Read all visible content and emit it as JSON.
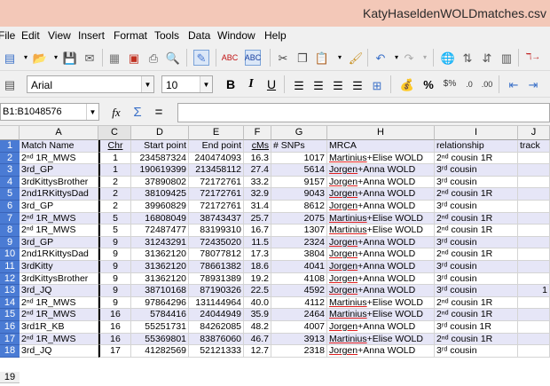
{
  "window": {
    "title": "KatyHaseldenWOLDmatches.csv"
  },
  "menu": [
    "File",
    "Edit",
    "View",
    "Insert",
    "Format",
    "Tools",
    "Data",
    "Window",
    "Help"
  ],
  "formatting": {
    "font_name": "Arial",
    "font_size": "10"
  },
  "formula_bar": {
    "name_box": "B1:B1048576",
    "content": ""
  },
  "columns": [
    "A",
    "C",
    "D",
    "E",
    "F",
    "G",
    "H",
    "I",
    "J"
  ],
  "header_row": {
    "num": "1",
    "cells": [
      "Match Name",
      "Chr",
      "Start point",
      "End point",
      "cMs",
      "# SNPs",
      "MRCA",
      "relationship",
      "track"
    ]
  },
  "rows": [
    {
      "num": "2",
      "name": "2ⁿᵈ 1R_MWS",
      "chr": "1",
      "start": "234587324",
      "end": "240474093",
      "cms": "16.3",
      "snps": "1017",
      "mrca": "Martinius+Elise WOLD",
      "rel": "2ⁿᵈ cousin 1R",
      "track": ""
    },
    {
      "num": "3",
      "name": "3rd_GP",
      "chr": "1",
      "start": "190619399",
      "end": "213458112",
      "cms": "27.4",
      "snps": "5614",
      "mrca": "Jorgen+Anna WOLD",
      "rel": "3ʳᵈ cousin",
      "track": ""
    },
    {
      "num": "4",
      "name": "3rdKittysBrother",
      "chr": "2",
      "start": "37890802",
      "end": "72172761",
      "cms": "33.2",
      "snps": "9157",
      "mrca": "Jorgen+Anna WOLD",
      "rel": "3ʳᵈ cousin",
      "track": ""
    },
    {
      "num": "5",
      "name": "2nd1RKittysDad",
      "chr": "2",
      "start": "38109425",
      "end": "72172761",
      "cms": "32.9",
      "snps": "9043",
      "mrca": "Jorgen+Anna WOLD",
      "rel": "2ⁿᵈ cousin 1R",
      "track": ""
    },
    {
      "num": "6",
      "name": "3rd_GP",
      "chr": "2",
      "start": "39960829",
      "end": "72172761",
      "cms": "31.4",
      "snps": "8612",
      "mrca": "Jorgen+Anna WOLD",
      "rel": "3ʳᵈ cousin",
      "track": ""
    },
    {
      "num": "7",
      "name": "2ⁿᵈ 1R_MWS",
      "chr": "5",
      "start": "16808049",
      "end": "38743437",
      "cms": "25.7",
      "snps": "2075",
      "mrca": "Martinius+Elise WOLD",
      "rel": "2ⁿᵈ cousin 1R",
      "track": ""
    },
    {
      "num": "8",
      "name": "2ⁿᵈ 1R_MWS",
      "chr": "5",
      "start": "72487477",
      "end": "83199310",
      "cms": "16.7",
      "snps": "1307",
      "mrca": "Martinius+Elise WOLD",
      "rel": "2ⁿᵈ cousin 1R",
      "track": ""
    },
    {
      "num": "9",
      "name": "3rd_GP",
      "chr": "9",
      "start": "31243291",
      "end": "72435020",
      "cms": "11.5",
      "snps": "2324",
      "mrca": "Jorgen+Anna WOLD",
      "rel": "3ʳᵈ cousin",
      "track": ""
    },
    {
      "num": "10",
      "name": "2nd1RKittysDad",
      "chr": "9",
      "start": "31362120",
      "end": "78077812",
      "cms": "17.3",
      "snps": "3804",
      "mrca": "Jorgen+Anna WOLD",
      "rel": "2ⁿᵈ cousin 1R",
      "track": ""
    },
    {
      "num": "11",
      "name": "3rdKitty",
      "chr": "9",
      "start": "31362120",
      "end": "78661382",
      "cms": "18.6",
      "snps": "4041",
      "mrca": "Jorgen+Anna WOLD",
      "rel": "3ʳᵈ cousin",
      "track": ""
    },
    {
      "num": "12",
      "name": "3rdKittysBrother",
      "chr": "9",
      "start": "31362120",
      "end": "78931389",
      "cms": "19.2",
      "snps": "4108",
      "mrca": "Jorgen+Anna WOLD",
      "rel": "3ʳᵈ cousin",
      "track": ""
    },
    {
      "num": "13",
      "name": "3rd_JQ",
      "chr": "9",
      "start": "38710168",
      "end": "87190326",
      "cms": "22.5",
      "snps": "4592",
      "mrca": "Jorgen+Anna WOLD",
      "rel": "3ʳᵈ cousin",
      "track": "1"
    },
    {
      "num": "14",
      "name": "2ⁿᵈ 1R_MWS",
      "chr": "9",
      "start": "97864296",
      "end": "131144964",
      "cms": "40.0",
      "snps": "4112",
      "mrca": "Martinius+Elise WOLD",
      "rel": "2ⁿᵈ cousin 1R",
      "track": ""
    },
    {
      "num": "15",
      "name": "2ⁿᵈ 1R_MWS",
      "chr": "16",
      "start": "5784416",
      "end": "24044949",
      "cms": "35.9",
      "snps": "2464",
      "mrca": "Martinius+Elise WOLD",
      "rel": "2ⁿᵈ cousin 1R",
      "track": ""
    },
    {
      "num": "16",
      "name": "3rd1R_KB",
      "chr": "16",
      "start": "55251731",
      "end": "84262085",
      "cms": "48.2",
      "snps": "4007",
      "mrca": "Jorgen+Anna WOLD",
      "rel": "3ʳᵈ cousin 1R",
      "track": ""
    },
    {
      "num": "17",
      "name": "2ⁿᵈ 1R_MWS",
      "chr": "16",
      "start": "55369801",
      "end": "83876060",
      "cms": "46.7",
      "snps": "3913",
      "mrca": "Martinius+Elise WOLD",
      "rel": "2ⁿᵈ cousin 1R",
      "track": ""
    },
    {
      "num": "18",
      "name": "3rd_JQ",
      "chr": "17",
      "start": "41282569",
      "end": "52121333",
      "cms": "12.7",
      "snps": "2318",
      "mrca": "Jorgen+Anna WOLD",
      "rel": "3ʳᵈ cousin",
      "track": ""
    }
  ],
  "trailing_row": {
    "num": "19"
  },
  "colors": {
    "title_bar": "#f3c8b8",
    "row_header_selected": "#4a7bd4",
    "row_band": "#e6e6f7"
  }
}
